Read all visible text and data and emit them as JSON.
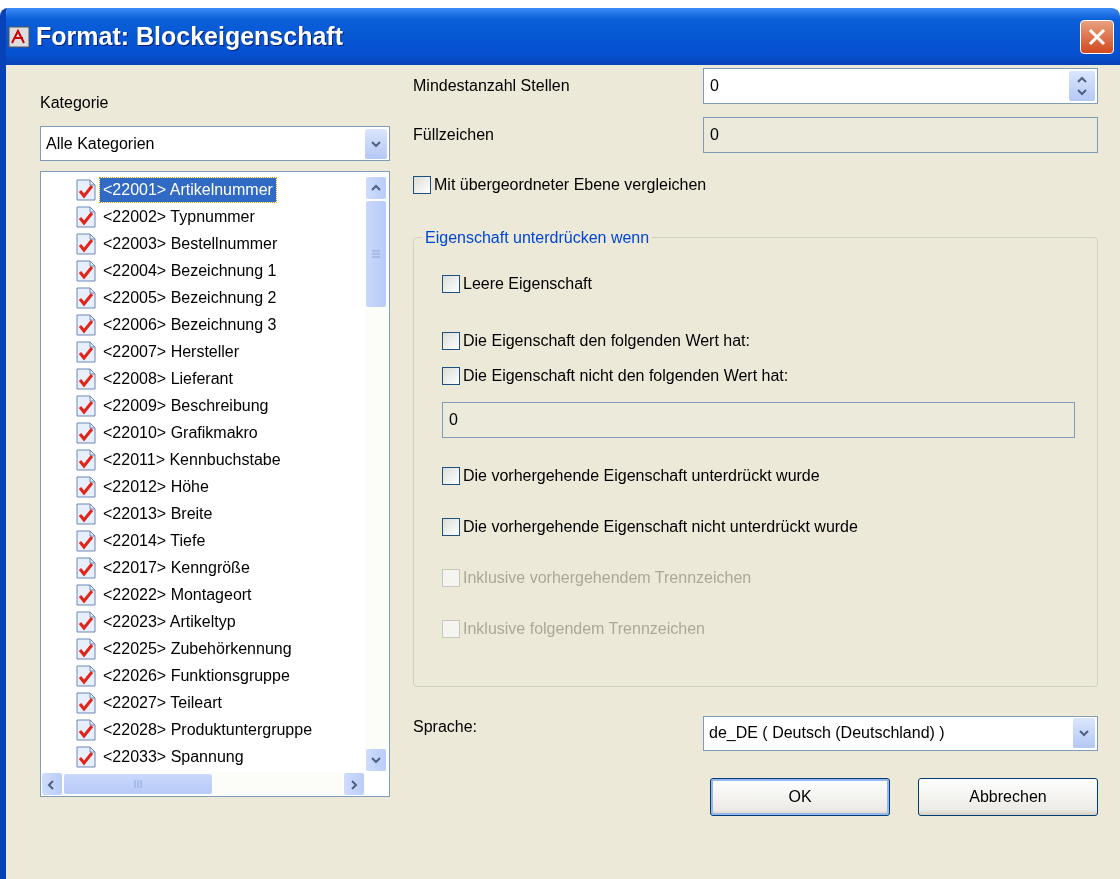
{
  "window": {
    "title": "Format: Blockeigenschaft"
  },
  "category": {
    "label": "Kategorie",
    "combo_value": "Alle Kategorien",
    "items": [
      {
        "label": "<22001> Artikelnummer",
        "checked": true,
        "selected": true
      },
      {
        "label": "<22002> Typnummer",
        "checked": true,
        "selected": false
      },
      {
        "label": "<22003> Bestellnummer",
        "checked": true,
        "selected": false
      },
      {
        "label": "<22004> Bezeichnung 1",
        "checked": true,
        "selected": false
      },
      {
        "label": "<22005> Bezeichnung 2",
        "checked": true,
        "selected": false
      },
      {
        "label": "<22006> Bezeichnung 3",
        "checked": true,
        "selected": false
      },
      {
        "label": "<22007> Hersteller",
        "checked": true,
        "selected": false
      },
      {
        "label": "<22008> Lieferant",
        "checked": true,
        "selected": false
      },
      {
        "label": "<22009> Beschreibung",
        "checked": true,
        "selected": false
      },
      {
        "label": "<22010> Grafikmakro",
        "checked": true,
        "selected": false
      },
      {
        "label": "<22011> Kennbuchstabe",
        "checked": true,
        "selected": false
      },
      {
        "label": "<22012> Höhe",
        "checked": true,
        "selected": false
      },
      {
        "label": "<22013> Breite",
        "checked": true,
        "selected": false
      },
      {
        "label": "<22014> Tiefe",
        "checked": true,
        "selected": false
      },
      {
        "label": "<22017> Kenngröße",
        "checked": true,
        "selected": false
      },
      {
        "label": "<22022> Montageort",
        "checked": true,
        "selected": false
      },
      {
        "label": "<22023> Artikeltyp",
        "checked": true,
        "selected": false
      },
      {
        "label": "<22025> Zubehörkennung",
        "checked": true,
        "selected": false
      },
      {
        "label": "<22026> Funktionsgruppe",
        "checked": true,
        "selected": false
      },
      {
        "label": "<22027> Teileart",
        "checked": true,
        "selected": false
      },
      {
        "label": "<22028> Produktuntergruppe",
        "checked": true,
        "selected": false
      },
      {
        "label": "<22033> Spannung",
        "checked": true,
        "selected": false
      }
    ]
  },
  "fields": [
    {
      "kind": "spinner",
      "label": "Mindestanzahl Stellen",
      "value": "0",
      "disabled": false
    },
    {
      "kind": "text",
      "label": "Füllzeichen",
      "value": "0",
      "disabled": true
    }
  ],
  "compare_checkbox": {
    "label": "Mit übergeordneter Ebene vergleichen",
    "checked": false
  },
  "suppress_group": {
    "title": "Eigenschaft unterdrücken wenn",
    "items": [
      {
        "kind": "checkbox",
        "label": "Leere Eigenschaft",
        "checked": false,
        "disabled": false
      },
      {
        "kind": "checkbox",
        "label": "Die Eigenschaft den folgenden Wert hat:",
        "checked": false,
        "disabled": false
      },
      {
        "kind": "checkbox",
        "label": "Die Eigenschaft nicht den folgenden Wert hat:",
        "checked": false,
        "disabled": false
      },
      {
        "kind": "field",
        "value": "0",
        "disabled": true
      },
      {
        "kind": "checkbox",
        "label": "Die vorhergehende Eigenschaft unterdrückt wurde",
        "checked": false,
        "disabled": false
      },
      {
        "kind": "checkbox",
        "label": "Die vorhergehende Eigenschaft nicht unterdrückt wurde",
        "checked": false,
        "disabled": false
      },
      {
        "kind": "checkbox",
        "label": "Inklusive vorhergehendem Trennzeichen",
        "checked": false,
        "disabled": true
      },
      {
        "kind": "checkbox",
        "label": "Inklusive folgendem Trennzeichen",
        "checked": false,
        "disabled": true
      }
    ]
  },
  "language": {
    "label": "Sprache:",
    "value": "de_DE ( Deutsch (Deutschland) )"
  },
  "buttons": [
    {
      "label": "OK",
      "default": true
    },
    {
      "label": "Abbrechen",
      "default": false
    }
  ]
}
